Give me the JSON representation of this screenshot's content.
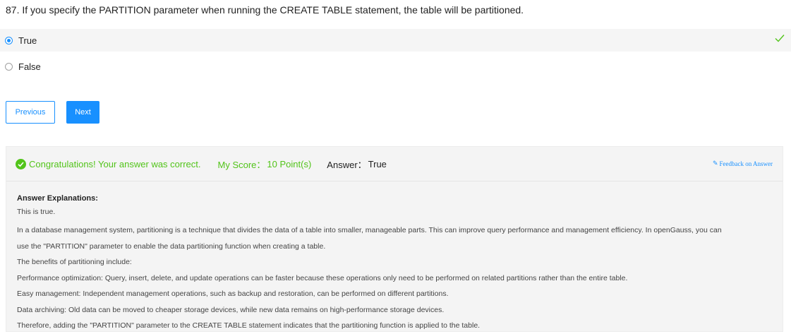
{
  "question": {
    "text": "87. If you specify the PARTITION parameter when running the CREATE TABLE statement, the table will be partitioned."
  },
  "options": [
    {
      "label": "True",
      "selected": true,
      "correct": true
    },
    {
      "label": "False",
      "selected": false
    }
  ],
  "navigation": {
    "previous_label": "Previous",
    "next_label": "Next"
  },
  "result": {
    "message": "Congratulations! Your answer was correct.",
    "score_label": "My Score：",
    "score_value": "10 Point(s)",
    "answer_label": "Answer：",
    "answer_value": "True",
    "feedback_label": "Feedback on Answer",
    "feedback_icon": "edit-icon"
  },
  "explanation": {
    "title": "Answer Explanations:",
    "lines": [
      "This is true.",
      "In a database management system, partitioning is a technique that divides the data of a table into smaller, manageable parts. This can improve query performance and management efficiency. In openGauss, you can",
      "use the \"PARTITION\" parameter to enable the data partitioning function when creating a table.",
      "The benefits of partitioning include:",
      "Performance optimization: Query, insert, delete, and update operations can be faster because these operations only need to be performed on related partitions rather than the entire table.",
      "Easy management: Independent management operations, such as backup and restoration, can be performed on different partitions.",
      "Data archiving: Old data can be moved to cheaper storage devices, while new data remains on high-performance storage devices.",
      "Therefore, adding the \"PARTITION\" parameter to the CREATE TABLE statement indicates that the partitioning function is applied to the table."
    ]
  },
  "colors": {
    "accent": "#1890ff",
    "success": "#52c41a"
  }
}
